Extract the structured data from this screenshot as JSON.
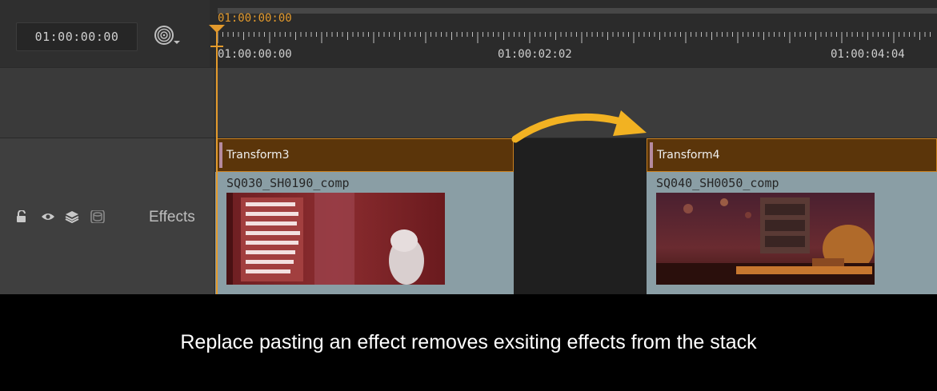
{
  "header": {
    "timecode": "01:00:00:00",
    "snap_icon": "snap-target-icon",
    "ruler": {
      "current_tc": "01:00:00:00",
      "labels": [
        "01:00:00:00",
        "01:00:02:02",
        "01:00:04:04"
      ]
    }
  },
  "track": {
    "name": "Effects",
    "icons": [
      "lock-icon",
      "eye-icon",
      "layers-icon",
      "disk-icon"
    ]
  },
  "clips": [
    {
      "effect_label": "Transform3",
      "clip_name": "SQ030_SH0190_comp"
    },
    {
      "effect_label": "Transform4",
      "clip_name": "SQ040_SH0050_comp"
    }
  ],
  "caption": "Replace pasting an effect removes exsiting effects from the stack",
  "colors": {
    "accent": "#e39a2c",
    "effect_bg": "#5b350a",
    "arrow": "#f2b222",
    "clip_bg": "#8a9ea5"
  }
}
